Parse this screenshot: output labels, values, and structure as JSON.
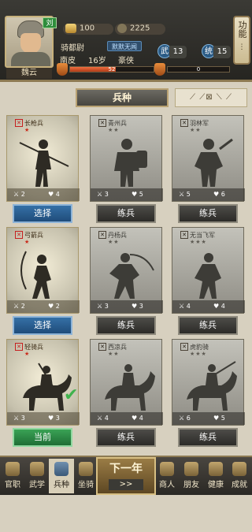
{
  "header": {
    "player_name": "魏云",
    "faction": "刘",
    "gold": "100",
    "copper": "2225",
    "title": "骑都尉",
    "title_tag": "默默无闻",
    "origin": "南皮",
    "age": "16岁",
    "trait": "豪侠",
    "wu_label": "武",
    "wu_value": "13",
    "tong_label": "统",
    "tong_value": "15",
    "bar1_value": "52",
    "bar1_fraction": 0.55,
    "bar2_value": "0",
    "bar2_fraction": 0.0,
    "func_button": "功能"
  },
  "category": {
    "title": "兵种",
    "filter_icons": "⟋ ⟋⊠ ⟍ ⟋"
  },
  "units": [
    {
      "name": "长枪兵",
      "stars": "★",
      "attack": "2",
      "defense": "4",
      "button": "选择",
      "state": "select"
    },
    {
      "name": "青州兵",
      "stars": "★★",
      "attack": "3",
      "defense": "5",
      "button": "练兵",
      "state": "train"
    },
    {
      "name": "羽林军",
      "stars": "★★",
      "attack": "5",
      "defense": "6",
      "button": "练兵",
      "state": "train"
    },
    {
      "name": "弓箭兵",
      "stars": "★",
      "attack": "2",
      "defense": "2",
      "button": "选择",
      "state": "select"
    },
    {
      "name": "丹杨兵",
      "stars": "★★",
      "attack": "3",
      "defense": "3",
      "button": "练兵",
      "state": "train"
    },
    {
      "name": "无当飞军",
      "stars": "★★★",
      "attack": "4",
      "defense": "4",
      "button": "练兵",
      "state": "train"
    },
    {
      "name": "轻骑兵",
      "stars": "★",
      "attack": "3",
      "defense": "3",
      "button": "当前",
      "state": "current"
    },
    {
      "name": "西凉兵",
      "stars": "★★",
      "attack": "4",
      "defense": "4",
      "button": "练兵",
      "state": "train"
    },
    {
      "name": "虎豹骑",
      "stars": "★★★",
      "attack": "6",
      "defense": "5",
      "button": "练兵",
      "state": "train"
    }
  ],
  "nav": {
    "items": [
      {
        "label": "官职",
        "icon": "official-icon"
      },
      {
        "label": "武学",
        "icon": "martial-icon"
      },
      {
        "label": "兵种",
        "icon": "troops-icon"
      },
      {
        "label": "坐骑",
        "icon": "mount-icon"
      },
      {
        "label": "商人",
        "icon": "merchant-icon"
      },
      {
        "label": "朋友",
        "icon": "friends-icon"
      },
      {
        "label": "健康",
        "icon": "health-icon"
      },
      {
        "label": "成就",
        "icon": "achievement-icon"
      }
    ],
    "next_year_label": "下一年",
    "next_year_arrows": ">>"
  },
  "colors": {
    "select_button": "#2a5e92",
    "train_button": "#3b3a36",
    "current_button": "#2e8a45",
    "accent_gold": "#b9a273"
  }
}
